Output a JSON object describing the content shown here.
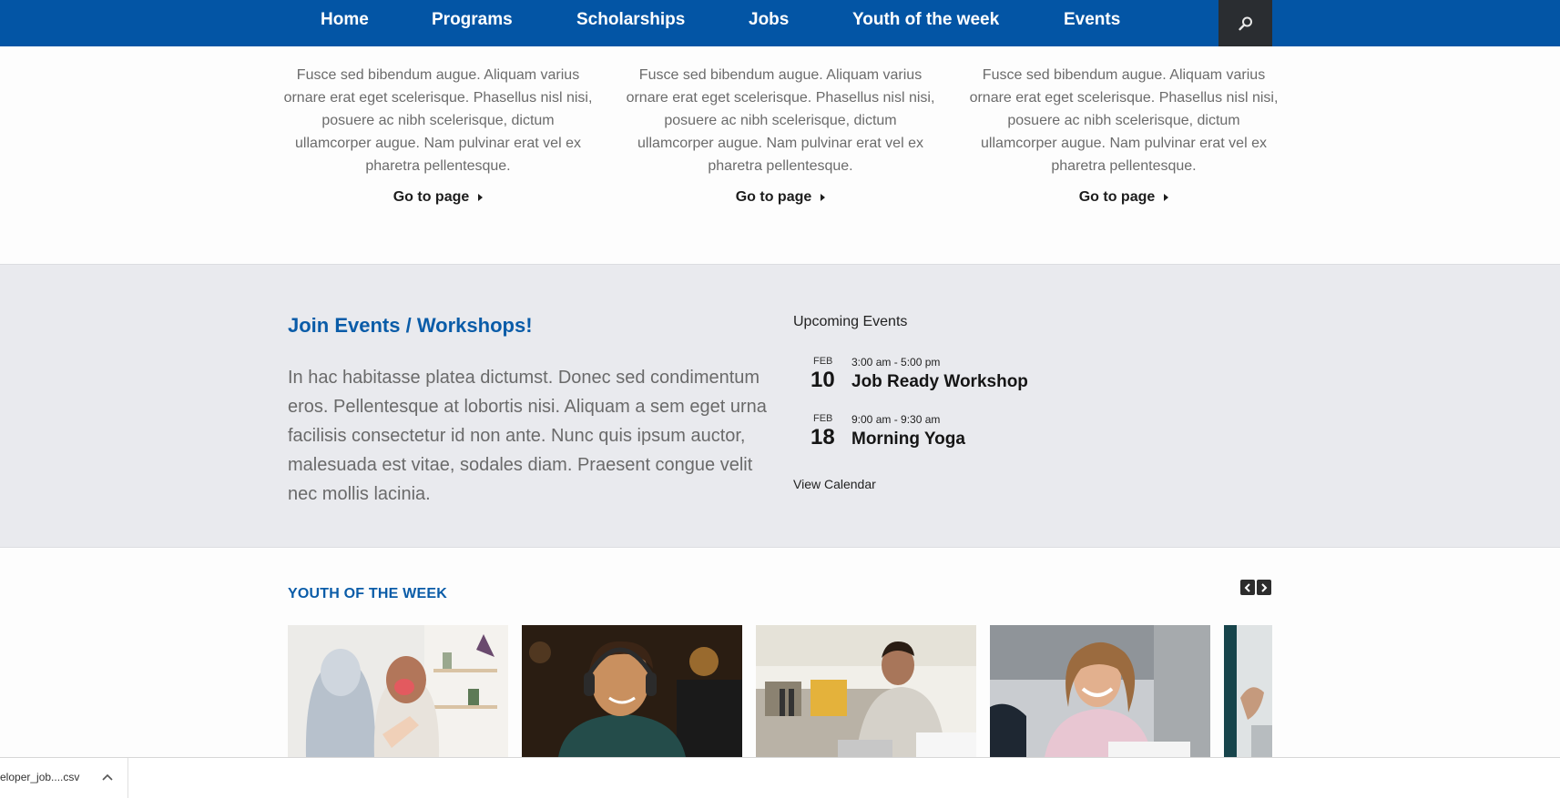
{
  "nav": {
    "items": [
      {
        "label": "Home"
      },
      {
        "label": "Programs"
      },
      {
        "label": "Scholarships"
      },
      {
        "label": "Jobs"
      },
      {
        "label": "Youth of the week"
      },
      {
        "label": "Events"
      }
    ],
    "search_icon": "search-icon",
    "colors": {
      "bar": "#0355a5",
      "search_bg": "#2a2d31"
    }
  },
  "cards": [
    {
      "text": "Fusce sed bibendum augue. Aliquam varius ornare erat eget scelerisque. Phasellus nisl nisi, posuere ac nibh scelerisque, dictum ullamcorper augue. Nam pulvinar erat vel ex pharetra pellentesque.",
      "link": "Go to page"
    },
    {
      "text": "Fusce sed bibendum augue. Aliquam varius ornare erat eget scelerisque. Phasellus nisl nisi, posuere ac nibh scelerisque, dictum ullamcorper augue. Nam pulvinar erat vel ex pharetra pellentesque.",
      "link": "Go to page"
    },
    {
      "text": "Fusce sed bibendum augue. Aliquam varius ornare erat eget scelerisque. Phasellus nisl nisi, posuere ac nibh scelerisque, dictum ullamcorper augue. Nam pulvinar erat vel ex pharetra pellentesque.",
      "link": "Go to page"
    }
  ],
  "events_section": {
    "heading": "Join Events / Workshops!",
    "description": "In hac habitasse platea dictumst. Donec sed condimentum eros. Pellentesque at lobortis nisi. Aliquam a sem eget urna facilisis consectetur id non ante. Nunc quis ipsum auctor, malesuada est vitae, sodales diam. Praesent congue velit nec mollis lacinia.",
    "upcoming_title": "Upcoming Events",
    "events": [
      {
        "month": "FEB",
        "day": "10",
        "time": "3:00 am - 5:00 pm",
        "name": "Job Ready Workshop"
      },
      {
        "month": "FEB",
        "day": "18",
        "time": "9:00 am - 9:30 am",
        "name": "Morning Yoga"
      }
    ],
    "view_calendar": "View Calendar",
    "colors": {
      "band": "#e9eaee",
      "heading": "#0a5ca8"
    }
  },
  "youth": {
    "title": "YOUTH OF THE WEEK",
    "prev_icon": "chevron-left-icon",
    "next_icon": "chevron-right-icon"
  },
  "download_bar": {
    "file_name": "eloper_job....csv",
    "chevron_icon": "chevron-up-icon"
  }
}
